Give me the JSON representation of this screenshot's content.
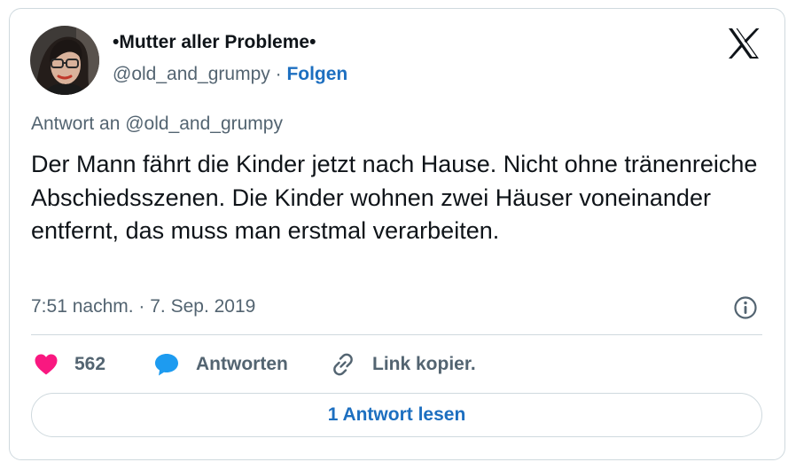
{
  "author": {
    "display_name": "•Mutter aller Probleme•",
    "handle": "@old_and_grumpy",
    "separator": " · ",
    "follow_label": "Folgen"
  },
  "tweet": {
    "reply_context": "Antwort an @old_and_grumpy",
    "text": "Der Mann fährt die Kinder jetzt nach Hause. Nicht ohne tränenreiche Abschiedsszenen. Die Kinder wohnen zwei Häuser voneinander entfernt, das muss man erstmal verarbeiten.",
    "timestamp": "7:51 nachm. · 7. Sep. 2019"
  },
  "actions": {
    "like_count": "562",
    "reply_label": "Antworten",
    "copy_link_label": "Link kopier."
  },
  "read_replies_label": "1 Antwort lesen",
  "icons": {
    "logo": "x-logo-icon",
    "info": "info-icon",
    "like": "heart-icon",
    "reply": "speech-bubble-icon",
    "copy_link": "link-icon"
  },
  "colors": {
    "heart": "#f91880",
    "reply_bubble": "#1d9bf0",
    "link_blue": "#1d6fc0",
    "text_primary": "#0f1419",
    "text_secondary": "#536471",
    "border": "#cfd9de"
  }
}
